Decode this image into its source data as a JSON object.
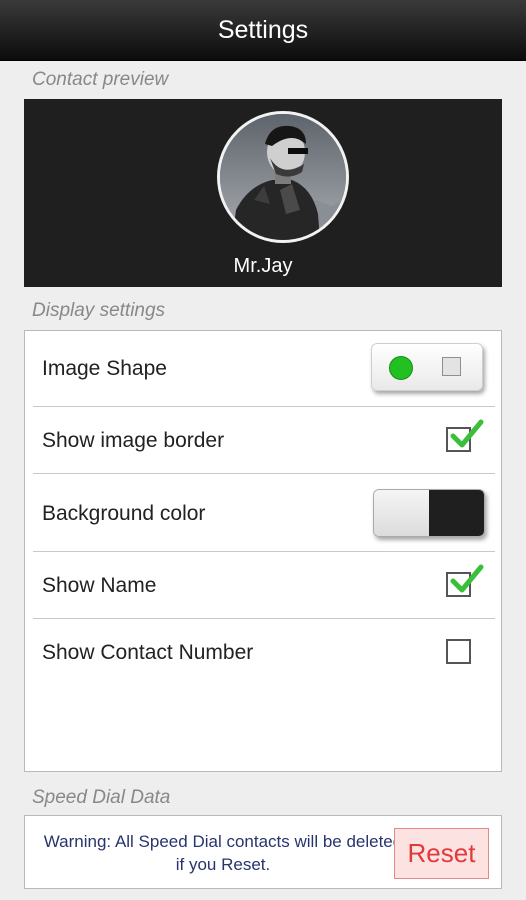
{
  "header": {
    "title": "Settings"
  },
  "preview": {
    "section_label": "Contact preview",
    "contact_name": "Mr.Jay"
  },
  "display": {
    "section_label": "Display settings",
    "rows": [
      {
        "label": "Image Shape",
        "control": "toggle-circle-square",
        "value": "circle"
      },
      {
        "label": "Show image border",
        "control": "checkbox",
        "checked": true
      },
      {
        "label": "Background color",
        "control": "toggle-light-dark",
        "value": "dark"
      },
      {
        "label": "Show Name",
        "control": "checkbox",
        "checked": true
      },
      {
        "label": "Show Contact Number",
        "control": "checkbox",
        "checked": false
      }
    ]
  },
  "speed_dial": {
    "section_label": "Speed Dial Data",
    "warning": "Warning: All Speed Dial contacts will be deleted if you Reset.",
    "reset_label": "Reset"
  },
  "colors": {
    "title_bar": "#111111",
    "preview_bg": "#1f1f1f",
    "check_green": "#3bbf3b",
    "toggle_dot": "#22c022",
    "warning_text": "#28346e",
    "reset_text": "#e23a3a",
    "reset_bg": "#fde2e2"
  }
}
